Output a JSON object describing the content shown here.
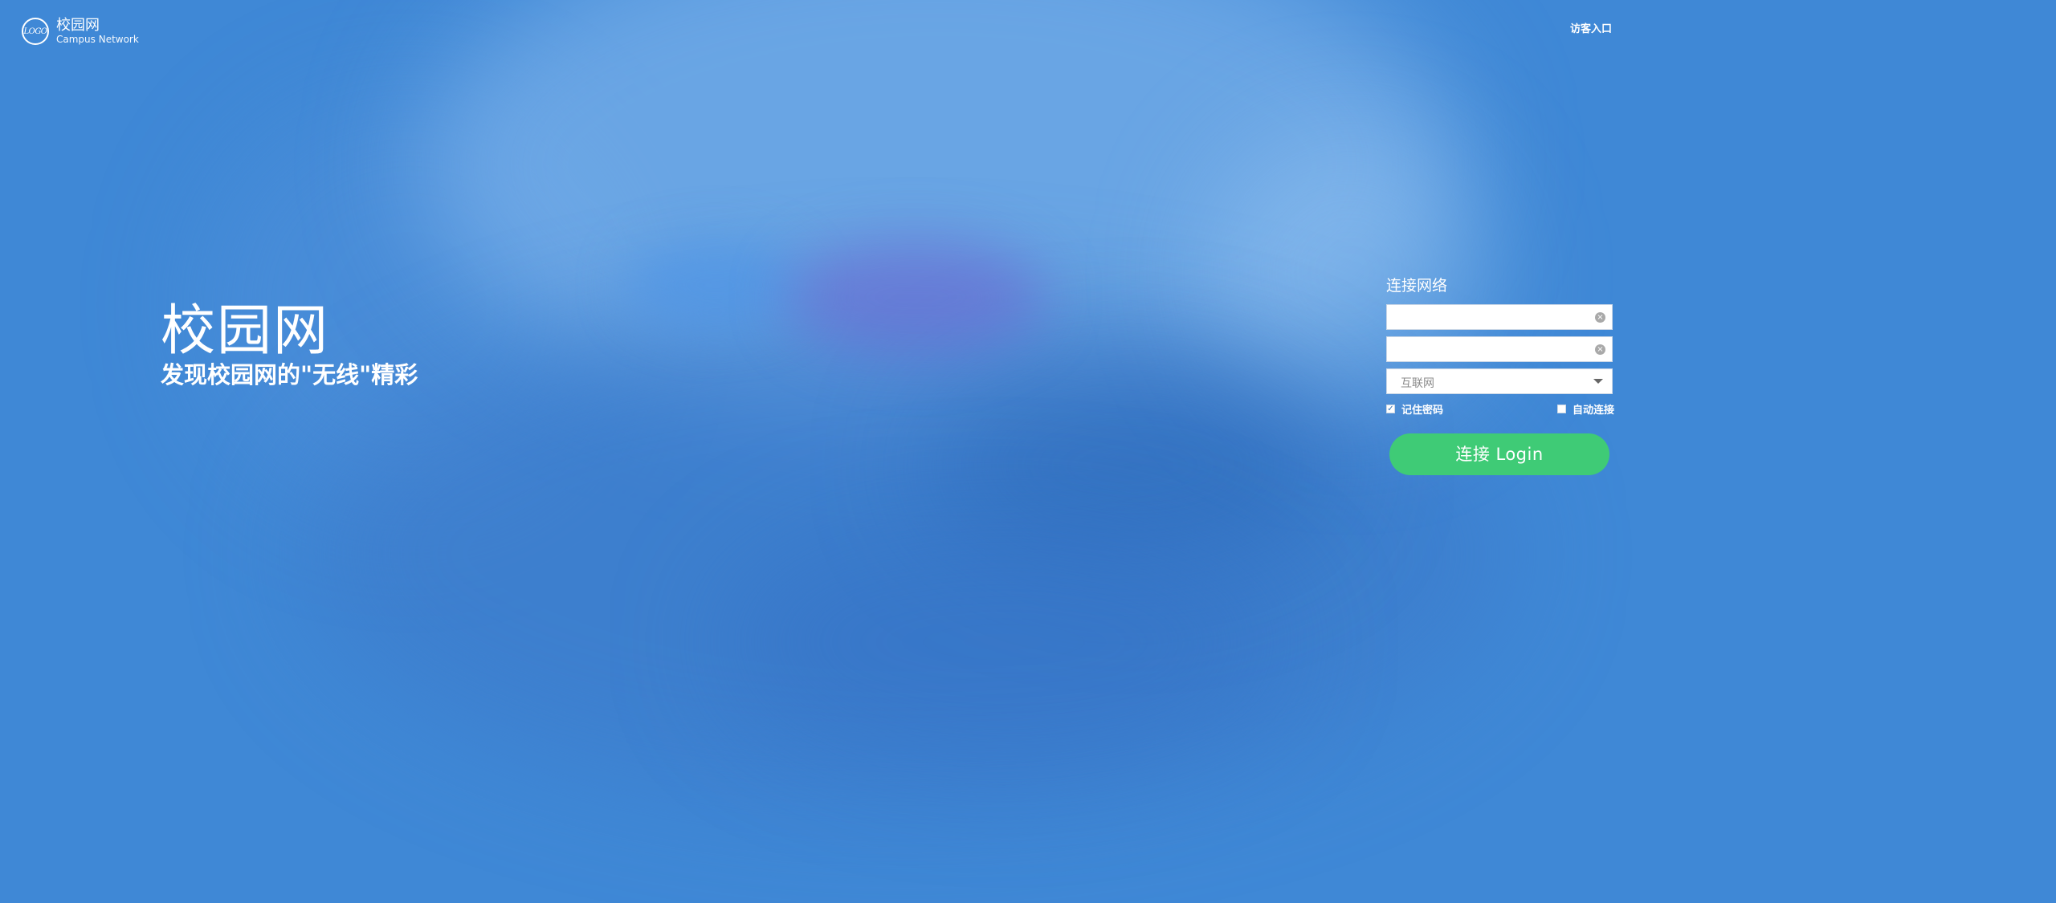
{
  "header": {
    "logo_mark": "LOGO",
    "logo_title": "校园网",
    "logo_subtitle": "Campus Network",
    "guest_link": "访客入口"
  },
  "hero": {
    "title": "校园网",
    "subtitle": "发现校园网的\"无线\"精彩"
  },
  "login": {
    "title": "连接网络",
    "username_value": "",
    "password_value": "",
    "network_selected": "互联网",
    "remember_password_label": "记住密码",
    "remember_password_checked": true,
    "auto_connect_label": "自动连接",
    "auto_connect_checked": false,
    "button_label": "连接 Login"
  },
  "colors": {
    "background": "#3f88d6",
    "button": "#3fcb76",
    "text": "#ffffff"
  },
  "icons": {
    "logo": "logo-circle-icon",
    "clear": "clear-icon",
    "dropdown": "chevron-down-icon",
    "checkbox_checked": "checkmark-icon"
  }
}
